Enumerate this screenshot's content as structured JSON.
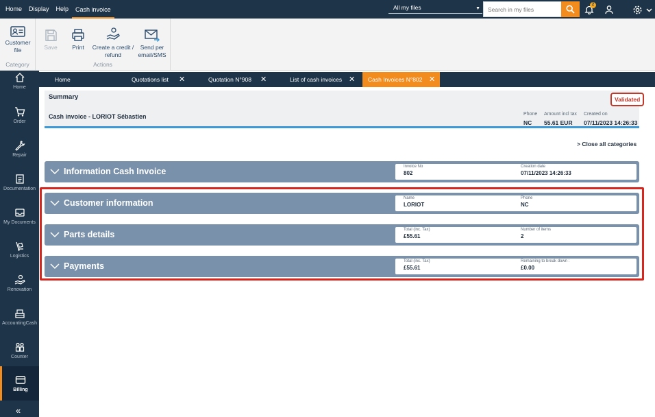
{
  "menu": {
    "items": [
      "Home",
      "Display",
      "Help",
      "Cash invoice"
    ],
    "active_index": 3
  },
  "top": {
    "files_select": "All my files",
    "search_placeholder": "Search in my files",
    "notification_count": "2"
  },
  "ribbon": {
    "category_group": {
      "label": "Category",
      "customer_file": "Customer file"
    },
    "actions_group": {
      "label": "Actions",
      "save": "Save",
      "print": "Print",
      "credit": "Create a credit / refund",
      "send": "Send per email/SMS"
    }
  },
  "sidebar": {
    "items": [
      {
        "label": "Home",
        "icon": "home-icon"
      },
      {
        "label": "Order",
        "icon": "cart-icon"
      },
      {
        "label": "Repair",
        "icon": "wrench-icon"
      },
      {
        "label": "Documentation",
        "icon": "document-icon"
      },
      {
        "label": "My Documents",
        "icon": "inbox-icon"
      },
      {
        "label": "Logistics",
        "icon": "trolley-icon"
      },
      {
        "label": "Renovation",
        "icon": "hand-coin-icon"
      },
      {
        "label": "AccountingCash",
        "icon": "register-icon"
      },
      {
        "label": "Counter",
        "icon": "people-icon"
      },
      {
        "label": "Billing",
        "icon": "card-icon"
      }
    ],
    "active": "Billing",
    "collapse": "«"
  },
  "tabs": [
    {
      "label": "Home",
      "closable": false
    },
    {
      "label": "Quotations list",
      "closable": true
    },
    {
      "label": "Quotation N°908",
      "closable": true
    },
    {
      "label": "List of cash invoices",
      "closable": true
    },
    {
      "label": "Cash Invoices N°802",
      "closable": true,
      "active": true
    }
  ],
  "summary": {
    "title": "Summary",
    "subtitle": "Cash invoice - LORIOT Sébastien",
    "status": "Validated",
    "status_color": "#c0392b",
    "fields": [
      {
        "label": "Phone",
        "value": "NC"
      },
      {
        "label": "Amount incl tax",
        "value": "55.61 EUR"
      },
      {
        "label": "Created on",
        "value": "07/11/2023 14:26:33"
      }
    ]
  },
  "close_all": "Close all categories",
  "sections": [
    {
      "title": "Information Cash Invoice",
      "fields": [
        {
          "label": "Invoice No",
          "value": "802"
        },
        {
          "label": "Creation date",
          "value": "07/11/2023 14:26:33"
        }
      ]
    },
    {
      "title": "Customer information",
      "fields": [
        {
          "label": "Name",
          "value": "LORIOT"
        },
        {
          "label": "Phone",
          "value": "NC"
        }
      ]
    },
    {
      "title": "Parts details",
      "fields": [
        {
          "label": "Total (inc. Tax)",
          "value": "£55.61"
        },
        {
          "label": "Number of items",
          "value": "2"
        }
      ]
    },
    {
      "title": "Payments",
      "fields": [
        {
          "label": "Total (inc. Tax)",
          "value": "£55.61"
        },
        {
          "label": "Remaining to break down :",
          "value": "£0.00"
        }
      ]
    }
  ],
  "colors": {
    "navy": "#1e3448",
    "accent": "#f28c1f",
    "section": "#7991ab",
    "highlight": "#d7261e"
  }
}
